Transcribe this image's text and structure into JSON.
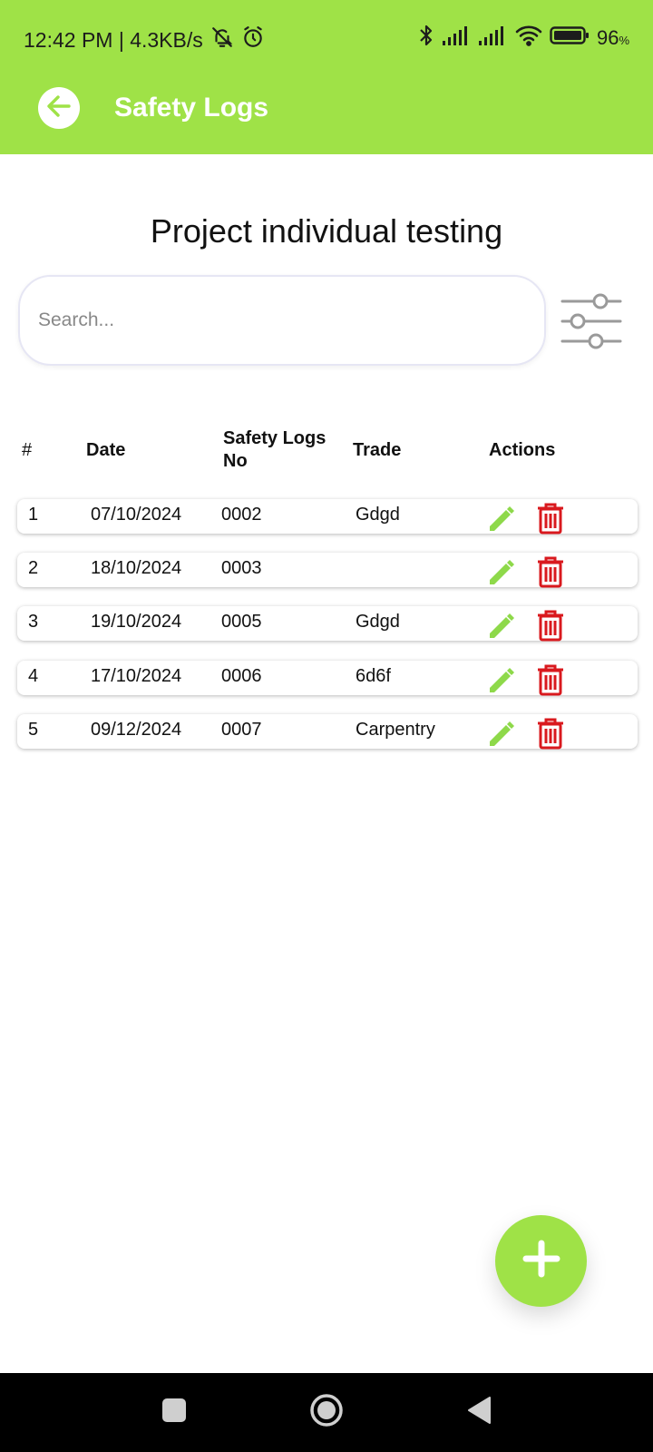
{
  "status_bar": {
    "time_speed": "12:42 PM | 4.3KB/s",
    "battery_percent": "96",
    "battery_unit": "%",
    "icons": [
      "mute-bell-icon",
      "alarm-icon",
      "bluetooth-icon",
      "signal-icon",
      "signal-icon",
      "wifi-icon",
      "battery-icon"
    ]
  },
  "app_bar": {
    "title": "Safety Logs",
    "back_icon": "arrow-left-icon",
    "background": "#9fe247"
  },
  "project": {
    "title": "Project individual testing"
  },
  "search": {
    "placeholder": "Search...",
    "value": "",
    "filter_icon": "sliders-icon"
  },
  "table": {
    "headers": {
      "num": "#",
      "date": "Date",
      "logs_no": "Safety Logs No",
      "trade": "Trade",
      "actions": "Actions"
    },
    "rows": [
      {
        "num": "1",
        "date": "07/10/2024",
        "logs_no": "0002",
        "trade": "Gdgd"
      },
      {
        "num": "2",
        "date": "18/10/2024",
        "logs_no": "0003",
        "trade": ""
      },
      {
        "num": "3",
        "date": "19/10/2024",
        "logs_no": "0005",
        "trade": "Gdgd"
      },
      {
        "num": "4",
        "date": "17/10/2024",
        "logs_no": "0006",
        "trade": "6d6f"
      },
      {
        "num": "5",
        "date": "09/12/2024",
        "logs_no": "0007",
        "trade": "Carpentry"
      }
    ],
    "edit_icon": "pencil-icon",
    "delete_icon": "trash-icon",
    "edit_color": "#8ed94a",
    "delete_color": "#d9191e"
  },
  "fab": {
    "icon": "plus-icon"
  },
  "nav_bar": {
    "icons": [
      "square-icon",
      "circle-home-icon",
      "triangle-back-icon"
    ]
  }
}
